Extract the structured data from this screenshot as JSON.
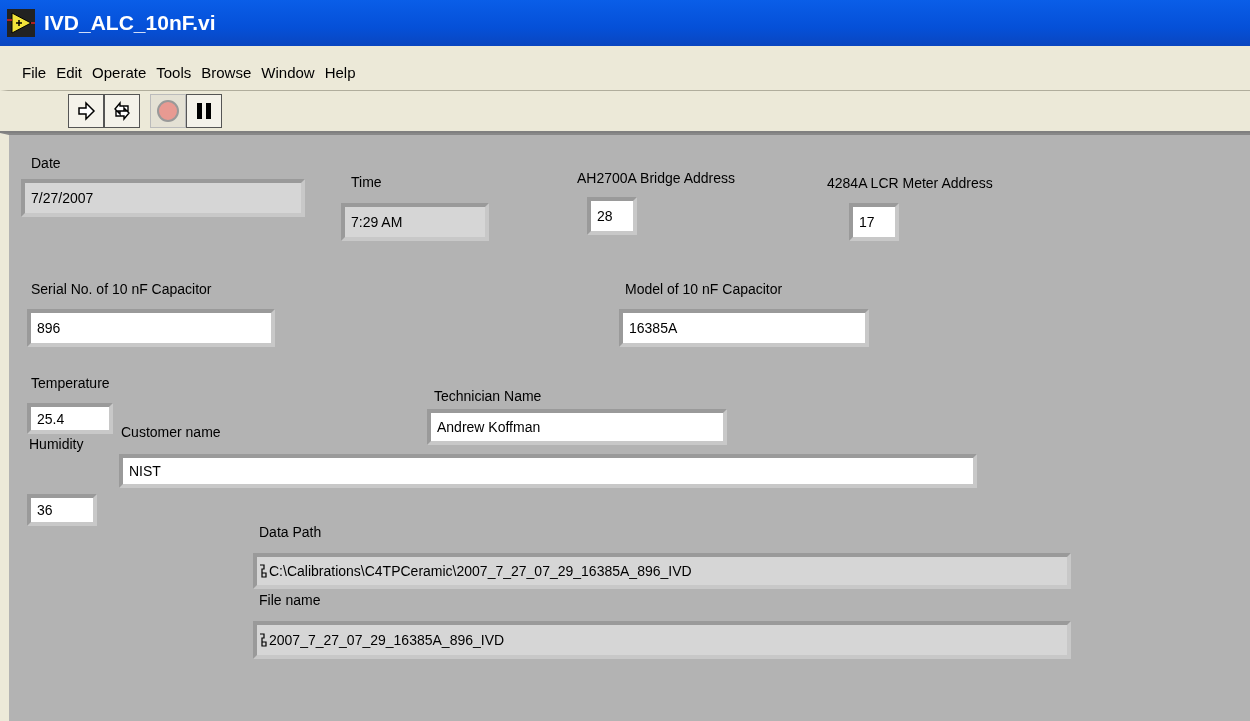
{
  "window": {
    "title": "IVD_ALC_10nF.vi"
  },
  "menu": [
    "File",
    "Edit",
    "Operate",
    "Tools",
    "Browse",
    "Window",
    "Help"
  ],
  "toolbar": [
    {
      "kind": "run",
      "disabled": false
    },
    {
      "kind": "run_continuous",
      "disabled": false
    },
    {
      "kind": "abort",
      "disabled": true
    },
    {
      "kind": "pause",
      "disabled": false
    }
  ],
  "controls": [
    {
      "label": "Date",
      "value": "7/27/2007",
      "kind": "indicator"
    },
    {
      "label": "Time",
      "value": "7:29 AM",
      "kind": "indicator"
    },
    {
      "label": "AH2700A Bridge Address",
      "value": "28",
      "kind": "control"
    },
    {
      "label": "4284A LCR Meter Address",
      "value": "17",
      "kind": "control"
    },
    {
      "label": "Serial No. of 10 nF Capacitor",
      "value": "896",
      "kind": "control"
    },
    {
      "label": "Model of 10 nF Capacitor",
      "value": "16385A",
      "kind": "control"
    },
    {
      "label": "Temperature",
      "value": "25.4",
      "kind": "control"
    },
    {
      "label": "Technician Name",
      "value": "Andrew Koffman",
      "kind": "control"
    },
    {
      "label": "Customer name",
      "value": "NIST",
      "kind": "control"
    },
    {
      "label": "Humidity",
      "value": "36",
      "kind": "control"
    },
    {
      "label": "Data Path",
      "value": "C:\\Calibrations\\C4TPCeramic\\2007_7_27_07_29_16385A_896_IVD",
      "kind": "path"
    },
    {
      "label": "File name",
      "value": "2007_7_27_07_29_16385A_896_IVD",
      "kind": "path"
    }
  ]
}
